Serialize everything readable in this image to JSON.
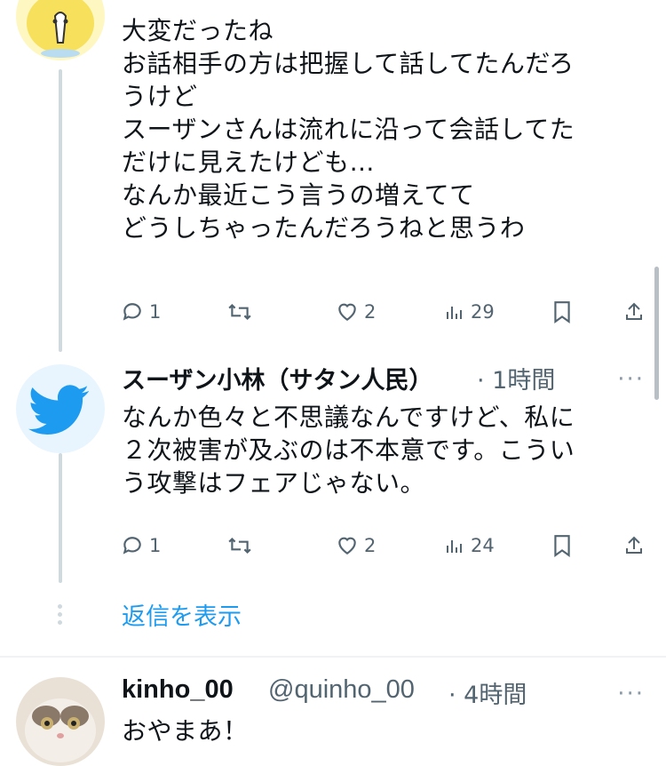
{
  "tweet1": {
    "lines": [
      "大変だったね",
      "お話相手の方は把握して話してたんだろ",
      "うけど",
      "スーザンさんは流れに沿って会話してた",
      "だけに見えたけども…",
      "なんか最近こう言うの増えてて",
      "どうしちゃったんだろうねと思うわ"
    ],
    "replies": "1",
    "likes": "2",
    "views": "29"
  },
  "tweet2": {
    "name": "スーザン小林（サタン人民）",
    "time": "· 1時間",
    "lines": [
      "なんか色々と不思議なんですけど、私に",
      "２次被害が及ぶのは不本意です。こうい",
      "う攻撃はフェアじゃない。"
    ],
    "replies": "1",
    "likes": "2",
    "views": "24"
  },
  "show_replies": "返信を表示",
  "tweet3": {
    "name": "kinho_00",
    "handle": "@quinho_00",
    "time": "· 4時間",
    "text": "おやまあ！"
  },
  "icons": {
    "reply": "reply-icon",
    "retweet": "retweet-icon",
    "like": "heart-icon",
    "views": "views-icon",
    "bookmark": "bookmark-icon",
    "share": "share-icon",
    "more": "more-icon"
  },
  "colors": {
    "accent": "#1d9bf0",
    "muted": "#536471",
    "line": "#cfd9de"
  }
}
